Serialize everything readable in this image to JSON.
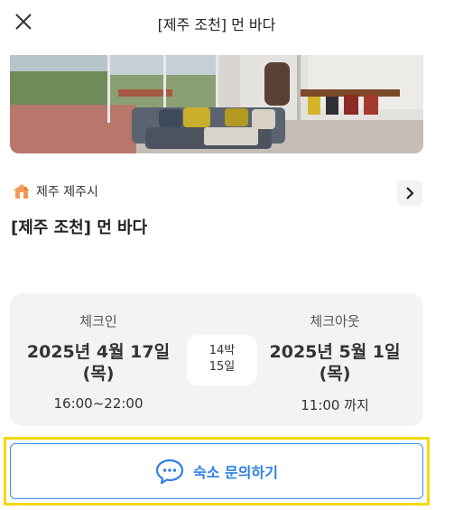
{
  "header": {
    "title": "[제주 조천] 먼 바다",
    "close_icon": "close-icon"
  },
  "hero": {
    "alt": "living-room-photo"
  },
  "location": {
    "icon": "home-icon",
    "text": "제주 제주시",
    "chevron_icon": "chevron-right-icon"
  },
  "listing": {
    "title": "[제주 조천] 먼 바다"
  },
  "stay": {
    "checkin_label": "체크인",
    "checkin_date": "2025년 4월 17일",
    "checkin_day": "(목)",
    "checkin_time": "16:00~22:00",
    "nights_line1": "14박",
    "nights_line2": "15일",
    "checkout_label": "체크아웃",
    "checkout_date": "2025년 5월 1일",
    "checkout_day": "(목)",
    "checkout_time": "11:00 까지"
  },
  "inquiry": {
    "label": "숙소 문의하기",
    "icon": "chat-bubble-icon"
  },
  "colors": {
    "accent": "#2f7fe6",
    "highlight": "#f5d90a",
    "card_bg": "#f3f3f4"
  }
}
